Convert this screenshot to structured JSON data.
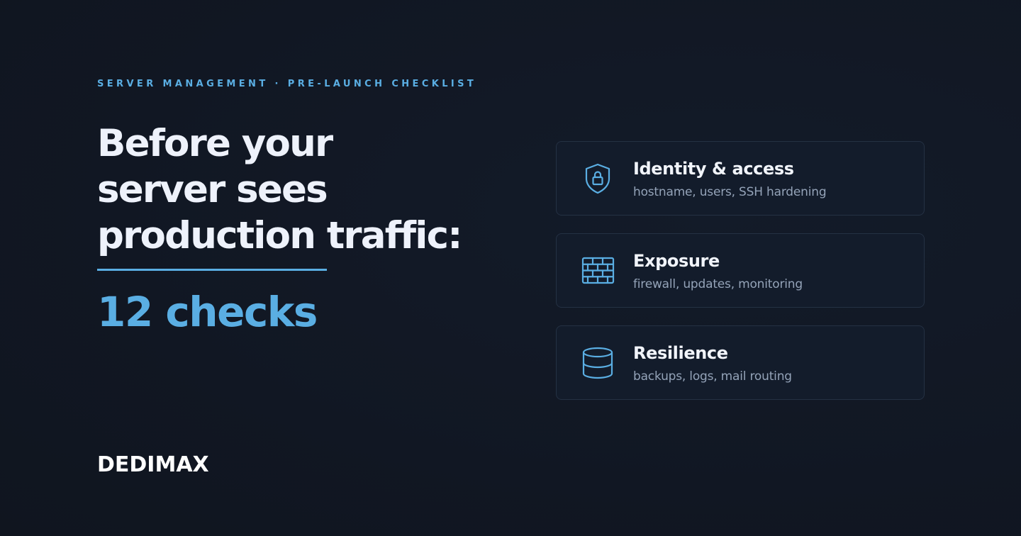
{
  "eyebrow": "SERVER MANAGEMENT · PRE-LAUNCH CHECKLIST",
  "headline": "Before your server sees production traffic:",
  "count": "12 checks",
  "brand": "DEDIMAX",
  "colors": {
    "background": "#111723",
    "accent": "#5aaee3",
    "card_background": "#131c2b",
    "card_border": "#243143",
    "title_text": "#eef2fb",
    "muted_text": "#94a3b8"
  },
  "cards": [
    {
      "icon": "shield-lock-icon",
      "title": "Identity & access",
      "subtitle": "hostname, users, SSH hardening"
    },
    {
      "icon": "firewall-brick-icon",
      "title": "Exposure",
      "subtitle": "firewall, updates, monitoring"
    },
    {
      "icon": "database-icon",
      "title": "Resilience",
      "subtitle": "backups, logs, mail routing"
    }
  ]
}
